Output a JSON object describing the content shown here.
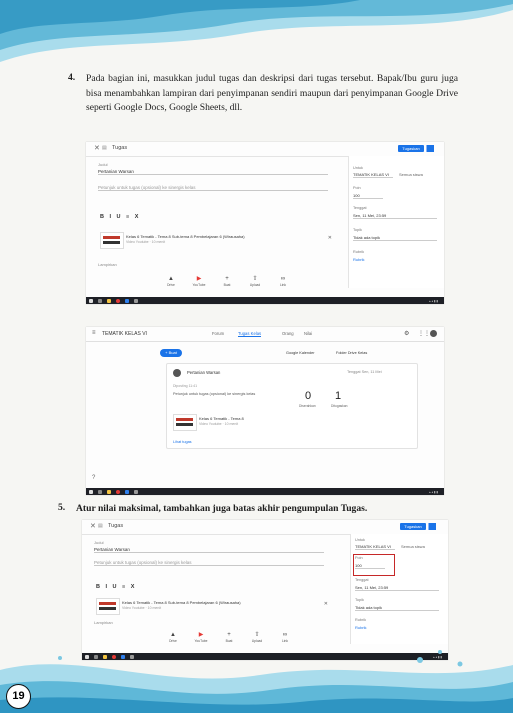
{
  "steps": [
    {
      "number": "4.",
      "text": "Pada bagian ini, masukkan judul tugas dan deskripsi dari tugas tersebut. Bapak/Ibu guru juga bisa menambahkan lampiran dari penyimpanan sendiri maupun dari penyimpanan Google Drive seperti Google Docs, Google Sheets, dll."
    },
    {
      "number": "5.",
      "text": "Atur nilai maksimal, tambahkan juga batas akhir pengumpulan Tugas."
    }
  ],
  "editor1": {
    "window_title": "Tugas",
    "assign_button": "Tugaskan",
    "title_value": "Pertanian Warsan",
    "desc_placeholder": "Petunjuk untuk tugas (opsional) ke sinergis kelas",
    "format_tools": "B I U ≡ X",
    "attachment_title": "Kelas 6 Tematik - Tema 8 Sub-tema 8 Pembelajaran 6 (Wirausaha)",
    "attachment_sub": "Video Youtube · 10 menit",
    "sidebar": {
      "for_label": "Untuk",
      "for_value": "TEMATIK KELAS VI",
      "students_value": "Semua siswa",
      "points_label": "Poin",
      "points_value": "100",
      "due_label": "Tenggat",
      "due_value": "Sen, 11 Mei, 23:59",
      "topic_label": "Topik",
      "topic_value": "Tidak ada topik",
      "rubric_label": "Rubrik",
      "rubric_value": "Rubrik"
    },
    "tools": [
      "Drive",
      "YouTube",
      "Buat",
      "Upload",
      "Link"
    ],
    "footer_label": "Lampirkan"
  },
  "classroom": {
    "class_name": "TEMATIK KELAS VI",
    "tabs": [
      "Forum",
      "Tugas Kelas",
      "Orang",
      "Nilai"
    ],
    "create_button": "+ Buat",
    "calendar_link": "Google Kalender",
    "folder_link": "Folder Drive Kelas",
    "assignment_title": "Pertanian Warsan",
    "assignment_meta": "Tenggat Sen, 11 Mei",
    "posted": "Diposting 11:41",
    "description": "Petunjuk untuk tugas (opsional) ke sinergis kelas",
    "count_submitted": "0",
    "label_submitted": "Diserahkan",
    "count_assigned": "1",
    "label_assigned": "Ditugaskan",
    "attachment_title": "Kelas 6 Tematik - Tema 8",
    "attachment_sub": "Video Youtube · 10 menit",
    "view_link": "Lihat tugas"
  },
  "editor2": {
    "window_title": "Tugas",
    "assign_button": "Tugaskan",
    "title_value": "Pertanian Warsan",
    "desc_placeholder": "Petunjuk untuk tugas (opsional) ke sinergis kelas",
    "format_tools": "B I U ≡ X",
    "attachment_title": "Kelas 6 Tematik - Tema 8 Sub-tema 8 Pembelajaran 6 (Wirausaha)",
    "attachment_sub": "Video Youtube · 10 menit",
    "sidebar": {
      "for_label": "Untuk",
      "for_value": "TEMATIK KELAS VI",
      "students_value": "Semua siswa",
      "points_label": "Poin",
      "points_value": "100",
      "due_label": "Tenggat",
      "due_value": "Sen, 11 Mei, 23:59",
      "topic_label": "Topik",
      "topic_value": "Tidak ada topik",
      "rubric_label": "Rubrik",
      "rubric_value": "Rubrik"
    },
    "tools": [
      "Drive",
      "YouTube",
      "Buat",
      "Upload",
      "Link"
    ],
    "footer_label": "Lampirkan"
  },
  "page_number": "19",
  "colors": {
    "accent": "#1a73e8",
    "highlight": "#c62828",
    "wave": "#5fb8d8"
  }
}
